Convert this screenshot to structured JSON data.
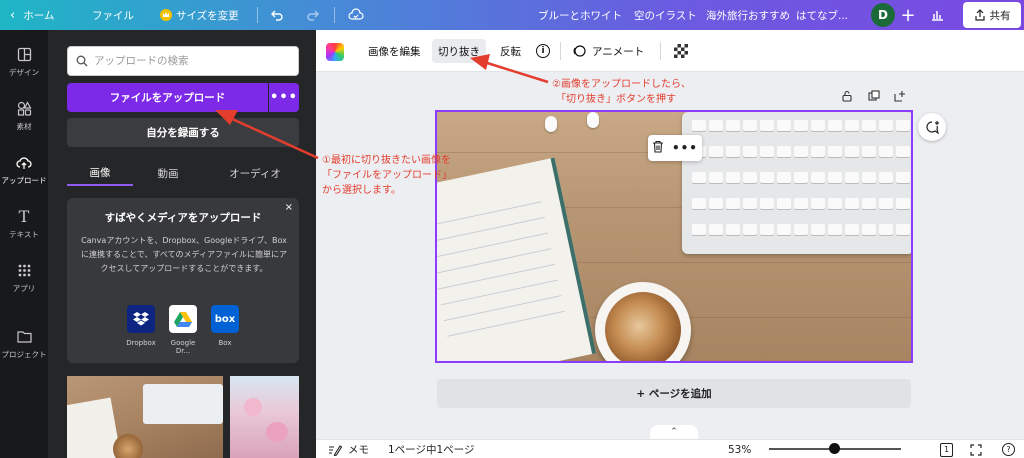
{
  "topbar": {
    "home": "ホーム",
    "file": "ファイル",
    "resize": "サイズを変更",
    "tags": [
      "ブルーとホワイト",
      "空のイラスト",
      "海外旅行おすすめ",
      "はてなブ..."
    ],
    "avatar_initial": "D",
    "share": "共有"
  },
  "rail": [
    {
      "label": "デザイン",
      "icon": "layout-icon"
    },
    {
      "label": "素材",
      "icon": "shapes-icon"
    },
    {
      "label": "アップロード",
      "icon": "cloud-upload-icon"
    },
    {
      "label": "テキスト",
      "icon": "text-icon"
    },
    {
      "label": "アプリ",
      "icon": "apps-grid-icon"
    },
    {
      "label": "プロジェクト",
      "icon": "folder-icon"
    }
  ],
  "panel": {
    "search_placeholder": "アップロードの検索",
    "upload_button": "ファイルをアップロード",
    "more_button": "•••",
    "record_button": "自分を録画する",
    "tabs": [
      "画像",
      "動画",
      "オーディオ"
    ],
    "card": {
      "close": "×",
      "title": "すばやくメディアをアップロード",
      "description": "Canvaアカウントを、Dropbox、Googleドライブ、Boxに連携することで、すべてのメディアファイルに簡単にアクセスしてアップロードすることができます。",
      "services": [
        {
          "name": "Dropbox",
          "color": "#0d2481"
        },
        {
          "name": "Google Dr...",
          "color": "#ffffff"
        },
        {
          "name": "Box",
          "color": "#0061d5"
        }
      ]
    }
  },
  "toolbar": {
    "edit_image": "画像を編集",
    "crop": "切り抜き",
    "flip": "反転",
    "info": "i",
    "animate": "アニメート"
  },
  "canvas": {
    "float_more": "•••",
    "add_page": "+ ページを追加",
    "handle": "⌃"
  },
  "bottombar": {
    "notes": "メモ",
    "page_count": "1ページ中1ページ",
    "zoom": "53%",
    "zoom_fraction": 0.49,
    "page_number": "1",
    "help": "?"
  },
  "annotations": {
    "step1": [
      "①最初に切り抜きたい画像を",
      "「ファイルをアップロード」",
      "から選択します。"
    ],
    "step2": [
      "②画像をアップロードしたら、",
      "「切り抜き」ボタンを押す"
    ]
  },
  "colors": {
    "accent": "#7d2ae8",
    "selection": "#8b3dff",
    "annotation": "#e33d2d"
  }
}
